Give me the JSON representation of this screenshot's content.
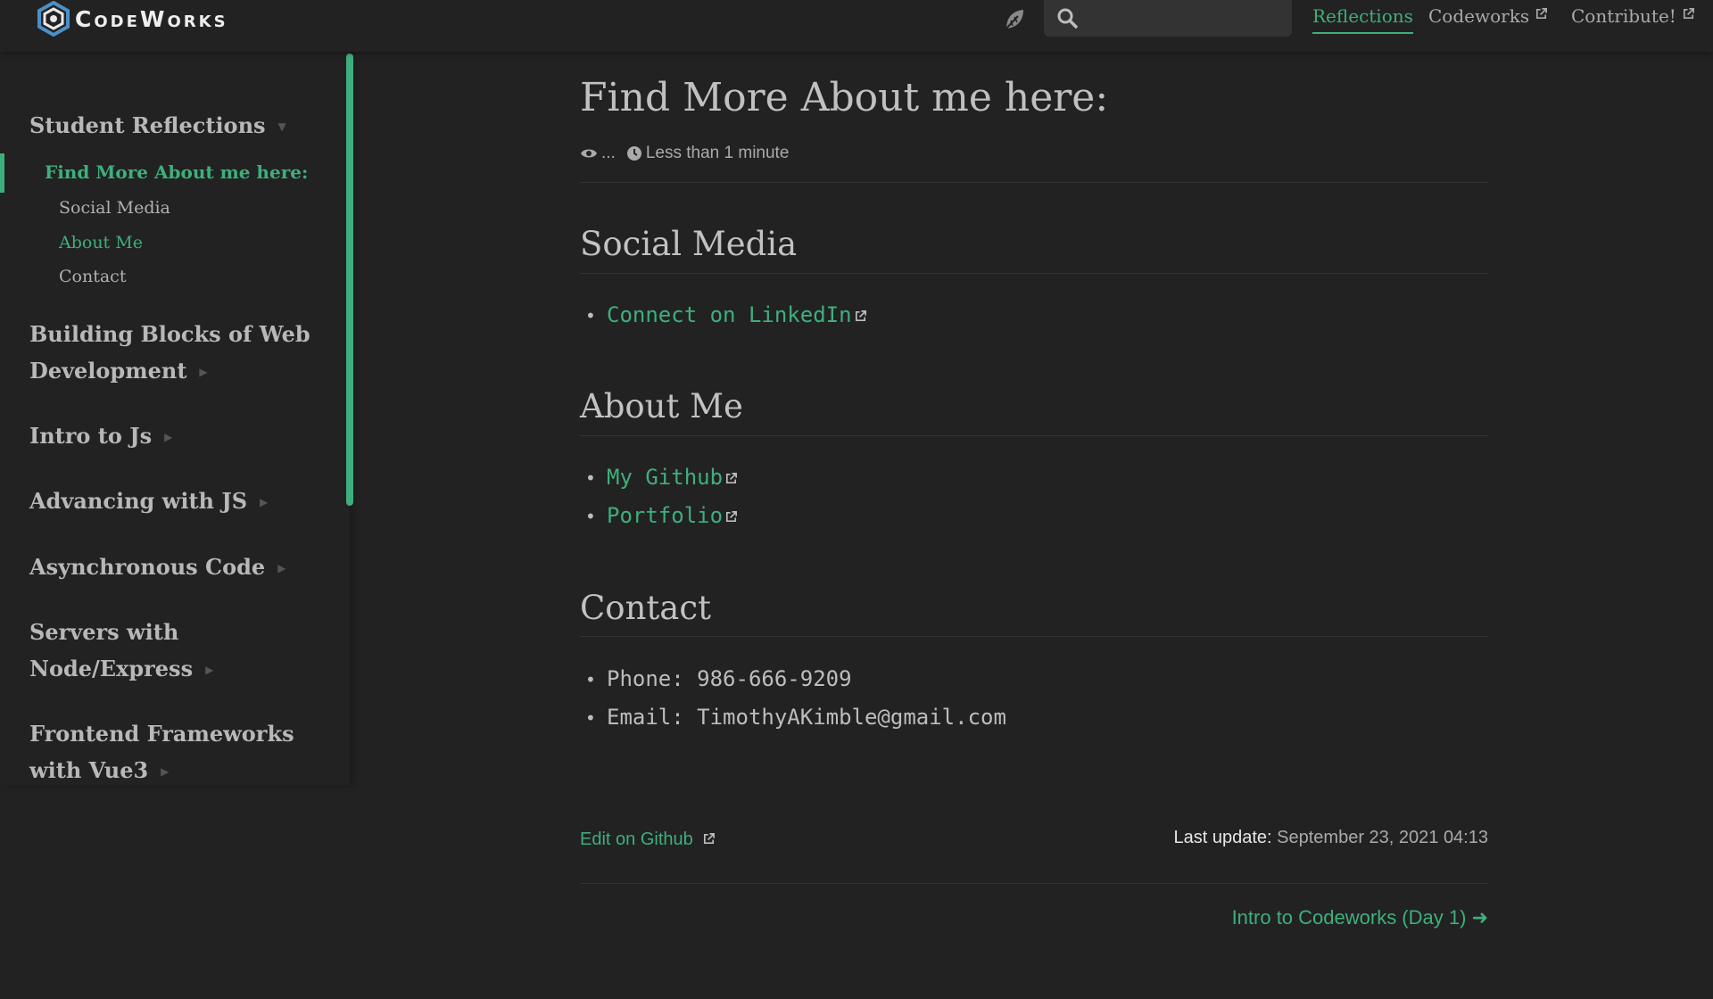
{
  "navbar": {
    "logo_text": "CodeWorks",
    "search": {
      "value": ""
    },
    "links": [
      {
        "label": "Reflections",
        "active": true,
        "external": false
      },
      {
        "label": "Codeworks",
        "active": false,
        "external": true
      },
      {
        "label": "Contribute!",
        "active": false,
        "external": true
      }
    ]
  },
  "sidebar": {
    "groups": [
      {
        "title": "Student Reflections",
        "expanded": true
      },
      {
        "title_line1": "Building Blocks of Web",
        "title_line2": "Development",
        "expanded": false
      },
      {
        "title": "Intro to Js",
        "expanded": false
      },
      {
        "title": "Advancing with JS",
        "expanded": false
      },
      {
        "title": "Asynchronous Code",
        "expanded": false
      },
      {
        "title_line1": "Servers with",
        "title_line2": "Node/Express",
        "expanded": false
      },
      {
        "title_line1": "Frontend Frameworks",
        "title_line2": "with Vue3",
        "expanded": false
      }
    ],
    "current_page": "Find More About me here:",
    "sub_items": [
      "Social Media",
      "About Me",
      "Contact"
    ]
  },
  "page": {
    "title": "Find More About me here:",
    "views": "...",
    "reading_time": "Less than 1 minute",
    "sections": {
      "social": {
        "heading": "Social Media",
        "links": [
          "Connect on LinkedIn"
        ]
      },
      "about": {
        "heading": "About Me",
        "links": [
          "My Github",
          "Portfolio"
        ]
      },
      "contact": {
        "heading": "Contact",
        "phone": "Phone: 986-666-9209",
        "email": "Email: TimothyAKimble@gmail.com"
      }
    },
    "footer": {
      "edit_link": "Edit on Github",
      "last_update_label": "Last update:",
      "last_update_value": "September 23, 2021 04:13",
      "next_link": "Intro to Codeworks (Day 1)",
      "next_arrow": "➜"
    }
  },
  "colors": {
    "accent": "#3eaf7c",
    "background": "#222222",
    "text": "#b4b4b4"
  }
}
